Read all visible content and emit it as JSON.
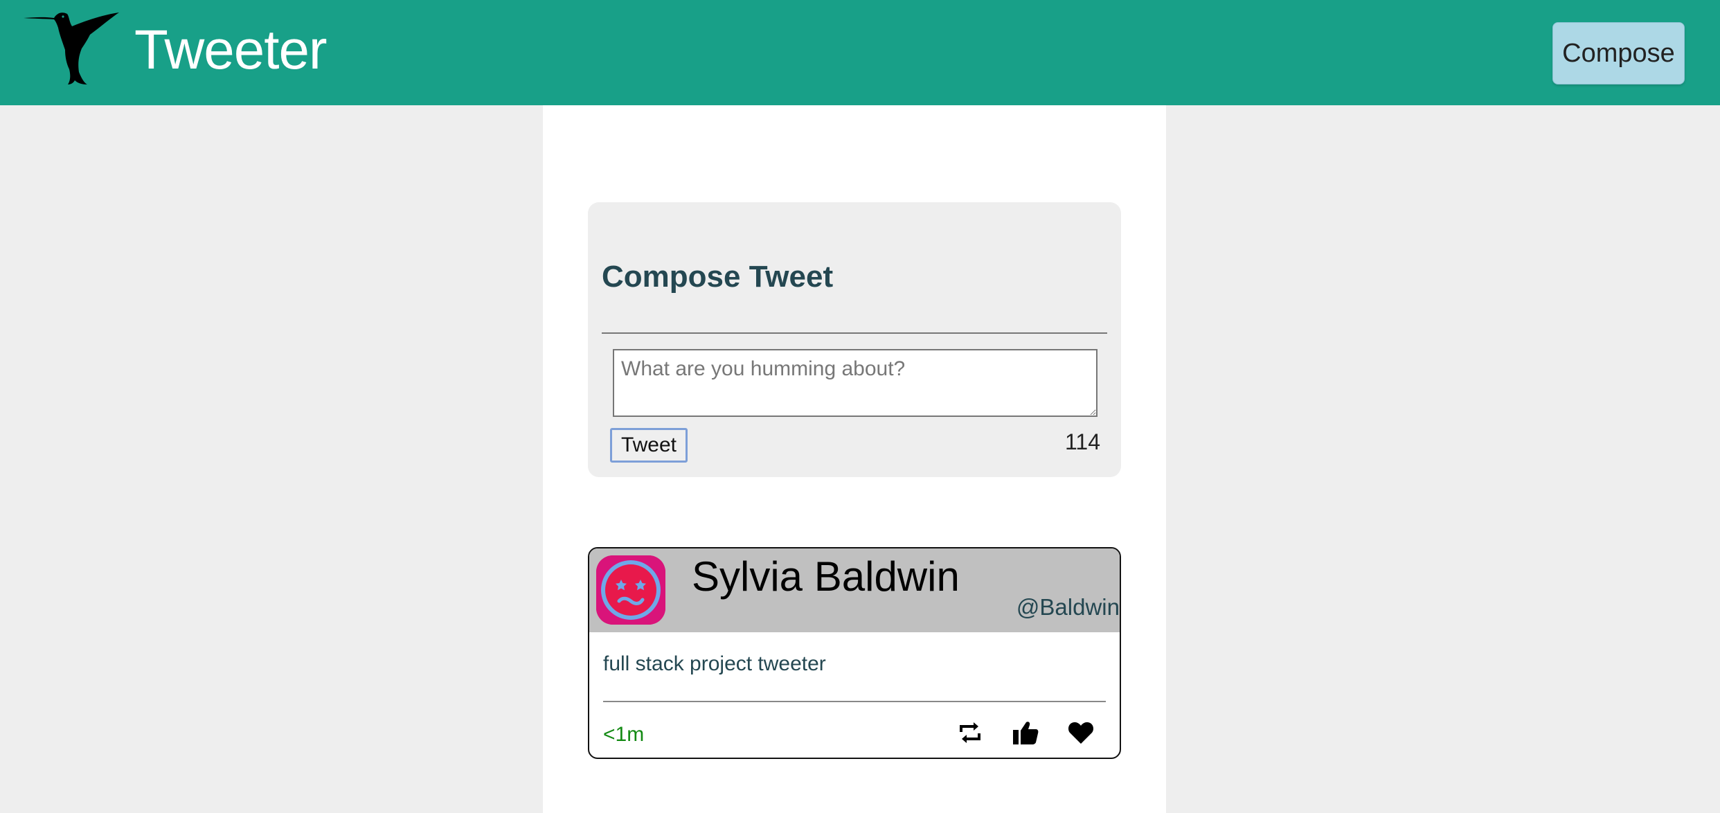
{
  "nav": {
    "brand": "Tweeter",
    "logo_icon": "hummingbird-icon",
    "compose_label": "Compose"
  },
  "compose": {
    "title": "Compose Tweet",
    "placeholder": "What are you humming about?",
    "submit_label": "Tweet",
    "char_counter": "114"
  },
  "tweet": {
    "name": "Sylvia Baldwin",
    "handle": "@Baldwin",
    "content": "full stack project tweeter",
    "time": "<1m",
    "actions": [
      "retweet-icon",
      "thumbs-up-icon",
      "heart-icon"
    ]
  },
  "colors": {
    "navbar": "#18a088",
    "compose_button": "#add8e6",
    "heading": "#244751",
    "timestamp": "#138a13",
    "background": "#eeeeee"
  }
}
